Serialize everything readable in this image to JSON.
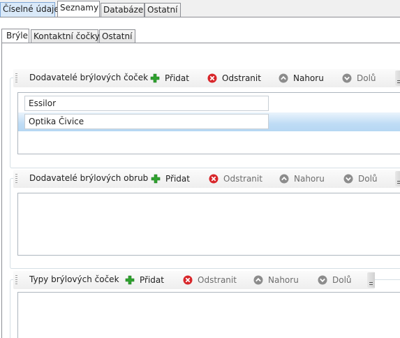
{
  "top_tabs": [
    "Číselné údaje",
    "Seznamy",
    "Databáze",
    "Ostatní"
  ],
  "inner_tabs": [
    "Brýle",
    "Kontaktní čočky",
    "Ostatní"
  ],
  "groups": [
    {
      "title": "Dodavatelé brýlových čoček",
      "add": "Přidat",
      "remove": "Odstranit",
      "up": "Nahoru",
      "down": "Dolů",
      "items": [
        "Essilor",
        "Optika Čivice"
      ]
    },
    {
      "title": "Dodavatelé brýlových obrub",
      "add": "Přidat",
      "remove": "Odstranit",
      "up": "Nahoru",
      "down": "Dolů",
      "items": []
    },
    {
      "title": "Typy brýlových čoček",
      "add": "Přidat",
      "remove": "Odstranit",
      "up": "Nahoru",
      "down": "Dolů",
      "items": []
    }
  ],
  "colors": {
    "add": "#2fa12f",
    "remove": "#d8262a",
    "nav": "#8c8c8c",
    "selection": "#bfdcf5"
  },
  "icons": {
    "add": "plus-icon",
    "remove": "delete-icon",
    "up": "arrow-up-icon",
    "down": "arrow-down-icon"
  }
}
